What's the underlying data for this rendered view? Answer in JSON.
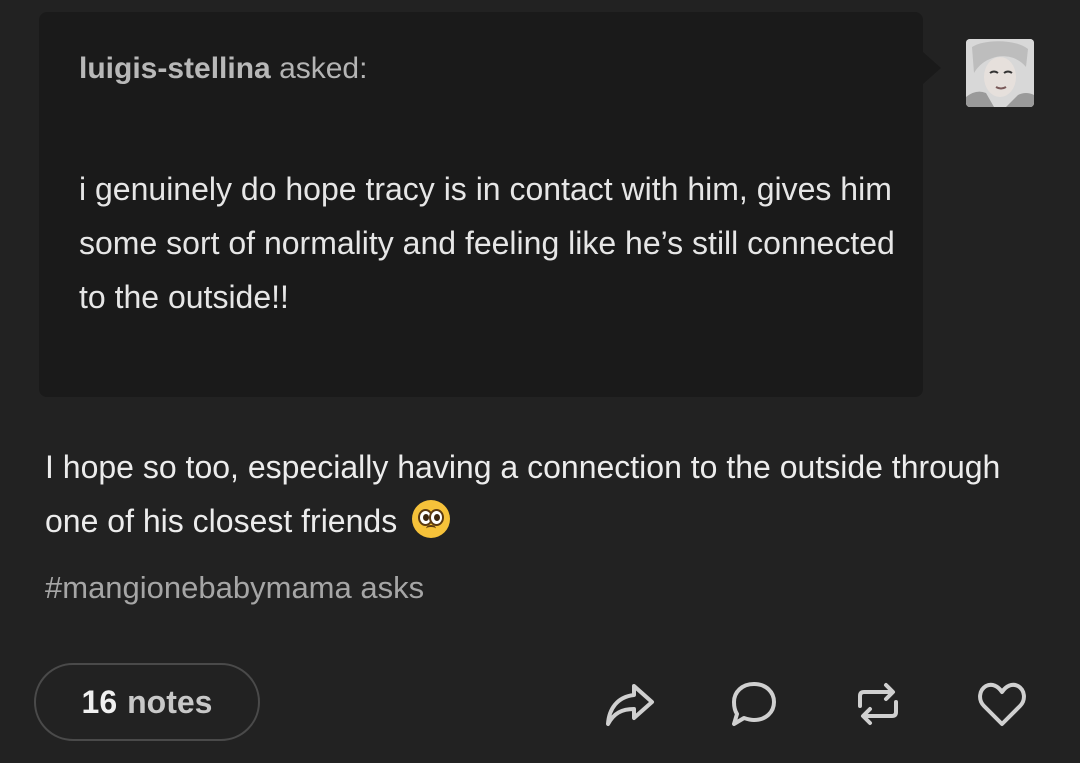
{
  "ask": {
    "asker": "luigis-stellina",
    "verb": "asked:",
    "body": "i genuinely do hope tracy is in contact with him, gives him some sort of normality and feeling like he’s still connected to the outside!!"
  },
  "answer": {
    "text": "I hope so too, especially having a connection to the outside through one of his closest friends",
    "emoji": "pleading-face-emoji"
  },
  "tags": "#mangionebabymama asks",
  "footer": {
    "notes_count": "16",
    "notes_label": "notes",
    "actions": [
      "share-icon",
      "reply-icon",
      "reblog-icon",
      "like-icon"
    ]
  },
  "colors": {
    "background": "#222222",
    "ask_background": "#1a1a1a",
    "text": "#e8e8e8",
    "muted": "#a6a6a6"
  }
}
